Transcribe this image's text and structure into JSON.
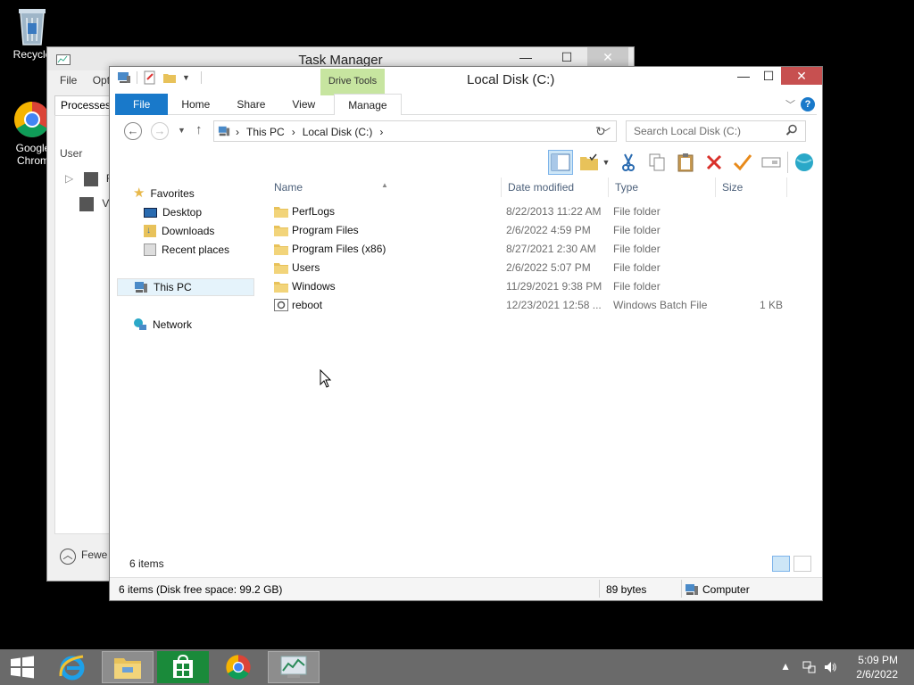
{
  "desktop": {
    "recycle_label": "Recycle",
    "chrome_label": "Google Chrom"
  },
  "taskmanager": {
    "title": "Task Manager",
    "menu": [
      "File",
      "Opti"
    ],
    "tab": "Processes",
    "user_header": "User",
    "rows": [
      "Fa",
      "VM"
    ],
    "fewer": "Fewe"
  },
  "explorer": {
    "title": "Local Disk (C:)",
    "drive_tools": "Drive Tools",
    "ribbon_tabs": {
      "file": "File",
      "home": "Home",
      "share": "Share",
      "view": "View",
      "manage": "Manage"
    },
    "breadcrumb": [
      "This PC",
      "Local Disk (C:)"
    ],
    "search_placeholder": "Search Local Disk (C:)",
    "nav": {
      "favorites": "Favorites",
      "desktop": "Desktop",
      "downloads": "Downloads",
      "recent": "Recent places",
      "thispc": "This PC",
      "network": "Network"
    },
    "columns": {
      "name": "Name",
      "date": "Date modified",
      "type": "Type",
      "size": "Size"
    },
    "files": [
      {
        "name": "PerfLogs",
        "date": "8/22/2013 11:22 AM",
        "type": "File folder",
        "size": ""
      },
      {
        "name": "Program Files",
        "date": "2/6/2022 4:59 PM",
        "type": "File folder",
        "size": ""
      },
      {
        "name": "Program Files (x86)",
        "date": "8/27/2021 2:30 AM",
        "type": "File folder",
        "size": ""
      },
      {
        "name": "Users",
        "date": "2/6/2022 5:07 PM",
        "type": "File folder",
        "size": ""
      },
      {
        "name": "Windows",
        "date": "11/29/2021 9:38 PM",
        "type": "File folder",
        "size": ""
      },
      {
        "name": "reboot",
        "date": "12/23/2021 12:58 ...",
        "type": "Windows Batch File",
        "size": "1 KB"
      }
    ],
    "item_count": "6 items",
    "status": {
      "left": "6 items (Disk free space: 99.2 GB)",
      "middle": "89 bytes",
      "right": "Computer"
    }
  },
  "taskbar": {
    "time": "5:09 PM",
    "date": "2/6/2022"
  },
  "colors": {
    "accent": "#1979ca",
    "drive_tools": "#c7e5a0",
    "close": "#c75050",
    "taskbar": "#6a6a6a"
  }
}
